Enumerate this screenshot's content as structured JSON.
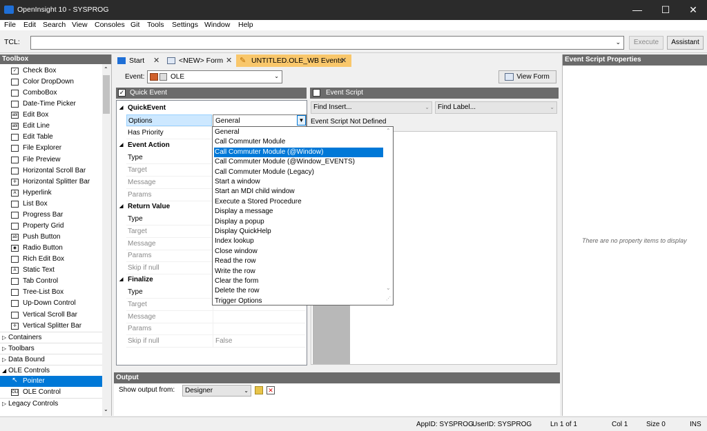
{
  "window": {
    "title": "OpenInsight 10 - SYSPROG",
    "minimize": "—",
    "maximize": "☐",
    "close": "✕",
    "app_icon": "openinsight-logo"
  },
  "menu": [
    "File",
    "Edit",
    "Search",
    "View",
    "Consoles",
    "Git",
    "Tools",
    "Settings",
    "Window",
    "Help"
  ],
  "tcl": {
    "label": "TCL:",
    "value": "",
    "execute": "Execute",
    "assistant": "Assistant"
  },
  "toolbox": {
    "title": "Toolbox",
    "items": [
      {
        "label": "Check Box",
        "icon": "checkbox-icon"
      },
      {
        "label": "Color DropDown",
        "icon": "color-dropdown-icon"
      },
      {
        "label": "ComboBox",
        "icon": "combobox-icon"
      },
      {
        "label": "Date-Time Picker",
        "icon": "datetime-icon"
      },
      {
        "label": "Edit Box",
        "icon": "editbox-icon"
      },
      {
        "label": "Edit Line",
        "icon": "editline-icon"
      },
      {
        "label": "Edit Table",
        "icon": "edittable-icon"
      },
      {
        "label": "File Explorer",
        "icon": "file-explorer-icon"
      },
      {
        "label": "File Preview",
        "icon": "file-preview-icon"
      },
      {
        "label": "Horizontal Scroll Bar",
        "icon": "hscroll-icon"
      },
      {
        "label": "Horizontal Splitter Bar",
        "icon": "hsplitter-icon"
      },
      {
        "label": "Hyperlink",
        "icon": "hyperlink-icon"
      },
      {
        "label": "List Box",
        "icon": "listbox-icon"
      },
      {
        "label": "Progress Bar",
        "icon": "progressbar-icon"
      },
      {
        "label": "Property Grid",
        "icon": "propertygrid-icon"
      },
      {
        "label": "Push Button",
        "icon": "pushbutton-icon"
      },
      {
        "label": "Radio Button",
        "icon": "radio-icon"
      },
      {
        "label": "Rich Edit Box",
        "icon": "richedit-icon"
      },
      {
        "label": "Static Text",
        "icon": "statictext-icon"
      },
      {
        "label": "Tab Control",
        "icon": "tabcontrol-icon"
      },
      {
        "label": "Tree-List Box",
        "icon": "treelist-icon"
      },
      {
        "label": "Up-Down Control",
        "icon": "updown-icon"
      },
      {
        "label": "Vertical Scroll Bar",
        "icon": "vscroll-icon"
      },
      {
        "label": "Vertical Splitter Bar",
        "icon": "vsplitter-icon"
      }
    ],
    "groups": {
      "containers": "Containers",
      "toolbars": "Toolbars",
      "databound": "Data Bound",
      "ole": "OLE Controls",
      "legacy": "Legacy Controls"
    },
    "ole_items": [
      {
        "label": "Pointer",
        "icon": "pointer-icon"
      },
      {
        "label": "OLE Control",
        "icon": "ole-icon"
      }
    ]
  },
  "tabs": [
    {
      "label": "Start",
      "icon": "openinsight-icon"
    },
    {
      "label": "<NEW> Form",
      "icon": "form-icon"
    },
    {
      "label": "UNTITLED.OLE_WB Events",
      "icon": "pencil-icon"
    }
  ],
  "event": {
    "label": "Event:",
    "value": "OLE",
    "view_form": "View Form"
  },
  "quick_event": {
    "header": "Quick Event",
    "checked": true,
    "categories": {
      "quickevent": "QuickEvent",
      "event_action": "Event Action",
      "return_value": "Return Value",
      "finalize": "Finalize"
    },
    "rows": {
      "options": {
        "name": "Options",
        "value": "General"
      },
      "has_priority": {
        "name": "Has Priority",
        "value": ""
      },
      "ea_type": "Type",
      "ea_target": "Target",
      "ea_message": "Message",
      "ea_params": "Params",
      "rv_type": "Type",
      "rv_target": "Target",
      "rv_message": "Message",
      "rv_params": "Params",
      "rv_skip": "Skip if null",
      "fn_type": "Type",
      "fn_target": "Target",
      "fn_message": "Message",
      "fn_params": "Params",
      "fn_skip": "Skip if null",
      "fn_skip_value": "False"
    }
  },
  "dropdown": {
    "options": [
      "General",
      "Call Commuter Module",
      "Call Commuter Module (@Window)",
      "Call Commuter Module (@Window_EVENTS)",
      "Call Commuter Module (Legacy)",
      "Start a window",
      "Start an MDI child window",
      "Execute a Stored Procedure",
      "Display a message",
      "Display a popup",
      "Display QuickHelp",
      "Index lookup",
      "Close window",
      "Read the row",
      "Write the row",
      "Clear the form",
      "Delete the row",
      "Trigger Options"
    ],
    "selected_index": 2
  },
  "event_script": {
    "header": "Event Script",
    "checked": false,
    "find_insert": "Find Insert...",
    "find_label": "Find Label...",
    "status": "Event Script Not Defined"
  },
  "properties": {
    "title": "Event Script Properties",
    "empty": "There are no property items to display"
  },
  "output": {
    "title": "Output",
    "show_label": "Show output from:",
    "source": "Designer"
  },
  "status": {
    "appid": "AppID: SYSPROG",
    "userid": "UserID: SYSPROG",
    "line": "Ln 1 of 1",
    "col": "Col 1",
    "size": "Size 0",
    "mode": "INS"
  },
  "colors": {
    "selection": "#0078d7",
    "header_bg": "#6b6b6b",
    "active_tab": "#f9c76b",
    "titlebar": "#2b2b2b"
  }
}
